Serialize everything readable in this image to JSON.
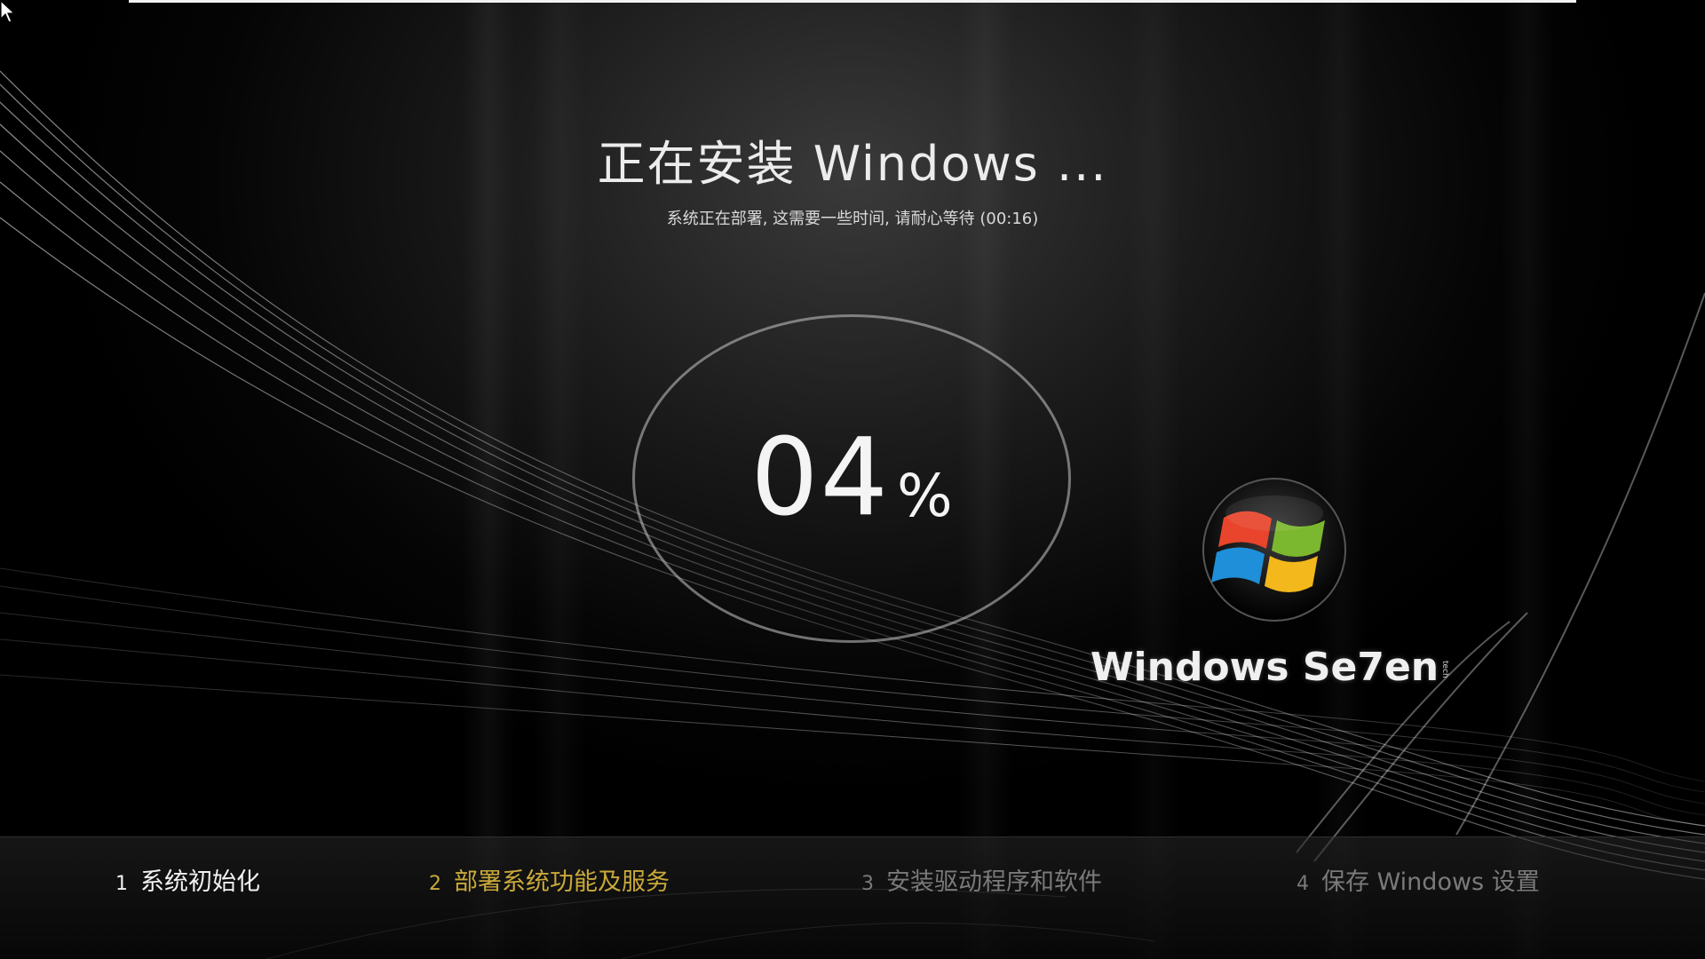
{
  "window": {
    "title": "正在安装 Windows ...",
    "subtitle": "系统正在部署, 这需要一些时间, 请耐心等待 (00:16)"
  },
  "progress": {
    "value": "04",
    "unit": "%",
    "fraction": 0.04
  },
  "brand": {
    "name": "Windows Se7en",
    "mark": "tech",
    "logo_icon": "windows-flag-icon"
  },
  "steps": [
    {
      "number": "1",
      "label": "系统初始化",
      "state": "done",
      "color": "#f2f2f2"
    },
    {
      "number": "2",
      "label": "部署系统功能及服务",
      "state": "active",
      "color": "#c9a93a"
    },
    {
      "number": "3",
      "label": "安装驱动程序和软件",
      "state": "pending",
      "color": "#7a7a7a"
    },
    {
      "number": "4",
      "label": "保存 Windows 设置",
      "state": "pending",
      "color": "#7a7a7a"
    }
  ],
  "icons": {
    "cursor": "mouse-pointer-icon"
  }
}
